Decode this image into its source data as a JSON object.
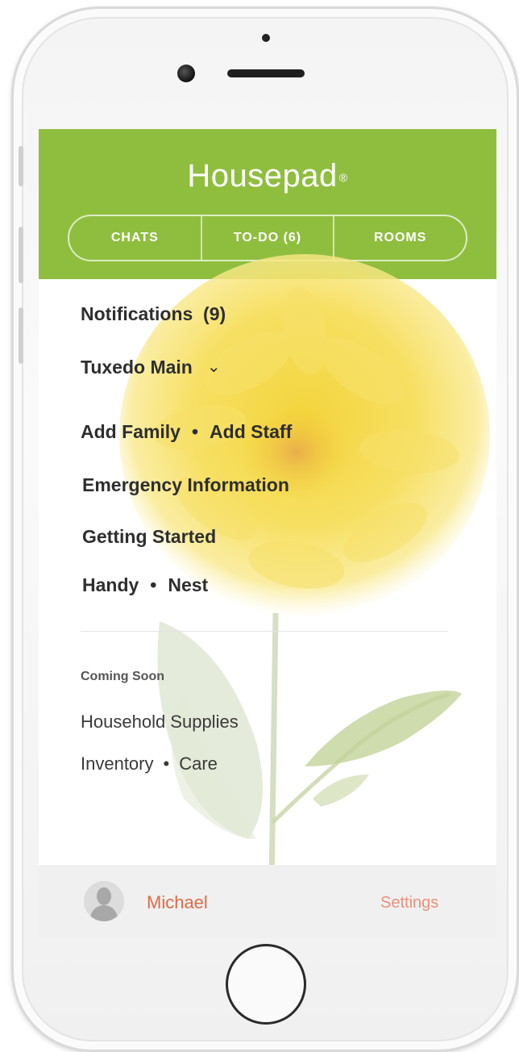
{
  "app": {
    "brand": "Housepad",
    "brand_mark": "®"
  },
  "tabs": [
    {
      "label": "CHATS"
    },
    {
      "label": "TO-DO (6)"
    },
    {
      "label": "ROOMS"
    }
  ],
  "menu": {
    "notifications": "Notifications  (9)",
    "home_selector": "Tuxedo Main",
    "add_family": "Add Family",
    "add_staff": "Add Staff",
    "emergency": "Emergency Information",
    "getting_started": "Getting Started",
    "handy": "Handy",
    "nest": "Nest",
    "separator": "•"
  },
  "coming_soon": {
    "label": "Coming Soon",
    "household_supplies": "Household Supplies",
    "inventory": "Inventory",
    "care": "Care"
  },
  "footer": {
    "user_name": "Michael",
    "settings": "Settings"
  },
  "colors": {
    "brand_green": "#8fbe3f",
    "accent_orange": "#e06a43"
  },
  "icons": {
    "home_chevron": "chevron-down-icon",
    "avatar": "user-silhouette-icon"
  }
}
